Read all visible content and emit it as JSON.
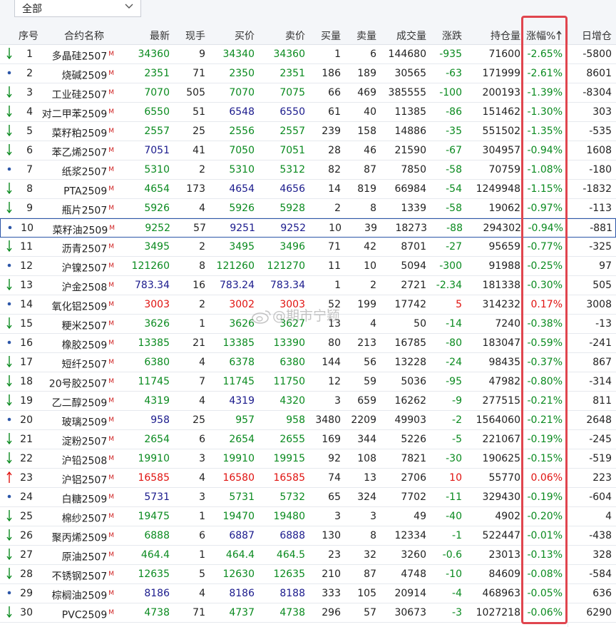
{
  "filter": {
    "label": "全部",
    "arrow_icon": "chevron-down-icon"
  },
  "headers": {
    "seq": "序号",
    "name": "合约名称",
    "last": "最新",
    "now": "现手",
    "bid": "买价",
    "ask": "卖价",
    "bid_vol": "买量",
    "ask_vol": "卖量",
    "volume": "成交量",
    "change": "涨跌",
    "open_interest": "持仓量",
    "pct": "涨幅%",
    "sort_icon": "arrow-up-icon",
    "oi_increase": "日增仓"
  },
  "colors": {
    "up": "#e0120f",
    "down": "#0a8a1f",
    "highlight_box": "#e0454e",
    "selected_row_border": "#2c56a8"
  },
  "watermark": "@期市宁颖",
  "rows": [
    {
      "ind": "down",
      "seq": "1",
      "name": "多晶硅2507",
      "mark": "M",
      "last": "34360",
      "now": "9",
      "bid": "34340",
      "ask": "34360",
      "bid_vol": "1",
      "ask_vol": "6",
      "volume": "144680",
      "change": "-935",
      "oi": "71600",
      "pct": "-2.65%",
      "inc": "-5800",
      "lc": "green",
      "bc": "green",
      "ac": "green"
    },
    {
      "ind": "dot",
      "seq": "2",
      "name": "烧碱2509",
      "mark": "M",
      "last": "2351",
      "now": "71",
      "bid": "2350",
      "ask": "2351",
      "bid_vol": "186",
      "ask_vol": "189",
      "volume": "30565",
      "change": "-63",
      "oi": "171999",
      "pct": "-2.61%",
      "inc": "8601",
      "lc": "green",
      "bc": "green",
      "ac": "green"
    },
    {
      "ind": "down",
      "seq": "3",
      "name": "工业硅2507",
      "mark": "M",
      "last": "7070",
      "now": "505",
      "bid": "7070",
      "ask": "7075",
      "bid_vol": "66",
      "ask_vol": "469",
      "volume": "385555",
      "change": "-100",
      "oi": "200193",
      "pct": "-1.39%",
      "inc": "-8304",
      "lc": "green",
      "bc": "green",
      "ac": "green"
    },
    {
      "ind": "down",
      "seq": "4",
      "name": "对二甲苯2509",
      "mark": "M",
      "last": "6550",
      "now": "51",
      "bid": "6548",
      "ask": "6550",
      "bid_vol": "61",
      "ask_vol": "40",
      "volume": "11385",
      "change": "-86",
      "oi": "151462",
      "pct": "-1.30%",
      "inc": "303",
      "lc": "green",
      "bc": "blue",
      "ac": "blue"
    },
    {
      "ind": "down",
      "seq": "5",
      "name": "菜籽粕2509",
      "mark": "M",
      "last": "2557",
      "now": "25",
      "bid": "2556",
      "ask": "2557",
      "bid_vol": "239",
      "ask_vol": "158",
      "volume": "14886",
      "change": "-35",
      "oi": "551502",
      "pct": "-1.35%",
      "inc": "-535",
      "lc": "green",
      "bc": "green",
      "ac": "green"
    },
    {
      "ind": "down",
      "seq": "6",
      "name": "苯乙烯2507",
      "mark": "M",
      "last": "7051",
      "now": "41",
      "bid": "7050",
      "ask": "7051",
      "bid_vol": "28",
      "ask_vol": "46",
      "volume": "21590",
      "change": "-67",
      "oi": "304957",
      "pct": "-0.94%",
      "inc": "1608",
      "lc": "blue",
      "bc": "green",
      "ac": "green"
    },
    {
      "ind": "dot",
      "seq": "7",
      "name": "纸浆2507",
      "mark": "M",
      "last": "5310",
      "now": "2",
      "bid": "5310",
      "ask": "5312",
      "bid_vol": "82",
      "ask_vol": "87",
      "volume": "7850",
      "change": "-58",
      "oi": "70759",
      "pct": "-1.08%",
      "inc": "-180",
      "lc": "green",
      "bc": "green",
      "ac": "green"
    },
    {
      "ind": "down",
      "seq": "8",
      "name": "PTA2509",
      "mark": "M",
      "last": "4654",
      "now": "173",
      "bid": "4654",
      "ask": "4656",
      "bid_vol": "14",
      "ask_vol": "819",
      "volume": "66984",
      "change": "-54",
      "oi": "1249948",
      "pct": "-1.15%",
      "inc": "-1832",
      "lc": "green",
      "bc": "blue",
      "ac": "blue"
    },
    {
      "ind": "down",
      "seq": "9",
      "name": "瓶片2507",
      "mark": "M",
      "last": "5926",
      "now": "4",
      "bid": "5926",
      "ask": "5928",
      "bid_vol": "2",
      "ask_vol": "8",
      "volume": "1339",
      "change": "-58",
      "oi": "19062",
      "pct": "-0.97%",
      "inc": "-113",
      "lc": "green",
      "bc": "green",
      "ac": "green"
    },
    {
      "ind": "dot",
      "seq": "10",
      "name": "菜籽油2509",
      "mark": "M",
      "last": "9252",
      "now": "57",
      "bid": "9251",
      "ask": "9252",
      "bid_vol": "10",
      "ask_vol": "39",
      "volume": "18273",
      "change": "-88",
      "oi": "294302",
      "pct": "-0.94%",
      "inc": "-881",
      "lc": "green",
      "bc": "blue",
      "ac": "blue",
      "sel": true
    },
    {
      "ind": "down",
      "seq": "11",
      "name": "沥青2507",
      "mark": "M",
      "last": "3495",
      "now": "2",
      "bid": "3495",
      "ask": "3496",
      "bid_vol": "71",
      "ask_vol": "42",
      "volume": "8701",
      "change": "-27",
      "oi": "95659",
      "pct": "-0.77%",
      "inc": "-325",
      "lc": "green",
      "bc": "green",
      "ac": "green"
    },
    {
      "ind": "dot",
      "seq": "12",
      "name": "沪镍2507",
      "mark": "M",
      "last": "121260",
      "now": "8",
      "bid": "121260",
      "ask": "121270",
      "bid_vol": "11",
      "ask_vol": "10",
      "volume": "5094",
      "change": "-300",
      "oi": "91988",
      "pct": "-0.25%",
      "inc": "97",
      "lc": "green",
      "bc": "green",
      "ac": "green"
    },
    {
      "ind": "down",
      "seq": "13",
      "name": "沪金2508",
      "mark": "M",
      "last": "783.34",
      "now": "16",
      "bid": "783.24",
      "ask": "783.34",
      "bid_vol": "1",
      "ask_vol": "2",
      "volume": "2721",
      "change": "-2.34",
      "oi": "181338",
      "pct": "-0.30%",
      "inc": "505",
      "lc": "blue",
      "bc": "blue",
      "ac": "blue"
    },
    {
      "ind": "dot",
      "seq": "14",
      "name": "氧化铝2509",
      "mark": "M",
      "last": "3003",
      "now": "2",
      "bid": "3002",
      "ask": "3003",
      "bid_vol": "52",
      "ask_vol": "199",
      "volume": "17742",
      "change": "5",
      "oi": "314232",
      "pct": "0.17%",
      "inc": "3008",
      "lc": "red",
      "bc": "red",
      "ac": "red"
    },
    {
      "ind": "down",
      "seq": "15",
      "name": "粳米2507",
      "mark": "M",
      "last": "3626",
      "now": "1",
      "bid": "3626",
      "ask": "3627",
      "bid_vol": "13",
      "ask_vol": "4",
      "volume": "50",
      "change": "-14",
      "oi": "7240",
      "pct": "-0.38%",
      "inc": "-13",
      "lc": "green",
      "bc": "green",
      "ac": "green"
    },
    {
      "ind": "dot",
      "seq": "16",
      "name": "橡胶2509",
      "mark": "M",
      "last": "13385",
      "now": "21",
      "bid": "13385",
      "ask": "13390",
      "bid_vol": "80",
      "ask_vol": "213",
      "volume": "16785",
      "change": "-80",
      "oi": "183047",
      "pct": "-0.59%",
      "inc": "-241",
      "lc": "green",
      "bc": "green",
      "ac": "green"
    },
    {
      "ind": "down",
      "seq": "17",
      "name": "短纤2507",
      "mark": "M",
      "last": "6380",
      "now": "4",
      "bid": "6378",
      "ask": "6380",
      "bid_vol": "144",
      "ask_vol": "56",
      "volume": "13228",
      "change": "-24",
      "oi": "98435",
      "pct": "-0.37%",
      "inc": "867",
      "lc": "green",
      "bc": "green",
      "ac": "green"
    },
    {
      "ind": "down",
      "seq": "18",
      "name": "20号胶2507",
      "mark": "M",
      "last": "11745",
      "now": "7",
      "bid": "11745",
      "ask": "11750",
      "bid_vol": "12",
      "ask_vol": "59",
      "volume": "5036",
      "change": "-95",
      "oi": "47982",
      "pct": "-0.80%",
      "inc": "-314",
      "lc": "green",
      "bc": "green",
      "ac": "green"
    },
    {
      "ind": "down",
      "seq": "19",
      "name": "乙二醇2509",
      "mark": "M",
      "last": "4319",
      "now": "4",
      "bid": "4319",
      "ask": "4320",
      "bid_vol": "3",
      "ask_vol": "659",
      "volume": "16262",
      "change": "-9",
      "oi": "277515",
      "pct": "-0.21%",
      "inc": "811",
      "lc": "green",
      "bc": "blue",
      "ac": "green"
    },
    {
      "ind": "dot",
      "seq": "20",
      "name": "玻璃2509",
      "mark": "M",
      "last": "958",
      "now": "25",
      "bid": "957",
      "ask": "958",
      "bid_vol": "3480",
      "ask_vol": "2209",
      "volume": "49903",
      "change": "-2",
      "oi": "1564060",
      "pct": "-0.21%",
      "inc": "2648",
      "lc": "blue",
      "bc": "green",
      "ac": "green"
    },
    {
      "ind": "down",
      "seq": "21",
      "name": "淀粉2507",
      "mark": "M",
      "last": "2654",
      "now": "6",
      "bid": "2654",
      "ask": "2655",
      "bid_vol": "169",
      "ask_vol": "344",
      "volume": "5226",
      "change": "-5",
      "oi": "221067",
      "pct": "-0.19%",
      "inc": "-245",
      "lc": "green",
      "bc": "green",
      "ac": "green"
    },
    {
      "ind": "down",
      "seq": "22",
      "name": "沪铅2508",
      "mark": "M",
      "last": "19910",
      "now": "3",
      "bid": "19910",
      "ask": "19915",
      "bid_vol": "92",
      "ask_vol": "108",
      "volume": "7821",
      "change": "-30",
      "oi": "190625",
      "pct": "-0.15%",
      "inc": "-519",
      "lc": "green",
      "bc": "green",
      "ac": "green"
    },
    {
      "ind": "up",
      "seq": "23",
      "name": "沪铝2507",
      "mark": "M",
      "last": "16585",
      "now": "4",
      "bid": "16580",
      "ask": "16585",
      "bid_vol": "74",
      "ask_vol": "13",
      "volume": "2706",
      "change": "10",
      "oi": "55770",
      "pct": "0.06%",
      "inc": "223",
      "lc": "red",
      "bc": "red",
      "ac": "red"
    },
    {
      "ind": "dot",
      "seq": "24",
      "name": "白糖2509",
      "mark": "M",
      "last": "5731",
      "now": "3",
      "bid": "5731",
      "ask": "5732",
      "bid_vol": "65",
      "ask_vol": "324",
      "volume": "7702",
      "change": "-11",
      "oi": "329430",
      "pct": "-0.19%",
      "inc": "-604",
      "lc": "blue",
      "bc": "green",
      "ac": "green"
    },
    {
      "ind": "down",
      "seq": "25",
      "name": "棉纱2507",
      "mark": "M",
      "last": "19475",
      "now": "1",
      "bid": "19470",
      "ask": "19480",
      "bid_vol": "3",
      "ask_vol": "3",
      "volume": "49",
      "change": "-40",
      "oi": "4902",
      "pct": "-0.20%",
      "inc": "4",
      "lc": "green",
      "bc": "green",
      "ac": "green"
    },
    {
      "ind": "down",
      "seq": "26",
      "name": "聚丙烯2509",
      "mark": "M",
      "last": "6888",
      "now": "6",
      "bid": "6887",
      "ask": "6888",
      "bid_vol": "130",
      "ask_vol": "8",
      "volume": "12334",
      "change": "-1",
      "oi": "522447",
      "pct": "-0.01%",
      "inc": "-438",
      "lc": "green",
      "bc": "blue",
      "ac": "blue"
    },
    {
      "ind": "down",
      "seq": "27",
      "name": "原油2507",
      "mark": "M",
      "last": "464.4",
      "now": "1",
      "bid": "464.4",
      "ask": "464.5",
      "bid_vol": "23",
      "ask_vol": "32",
      "volume": "3260",
      "change": "-0.6",
      "oi": "23013",
      "pct": "-0.13%",
      "inc": "328",
      "lc": "green",
      "bc": "green",
      "ac": "green"
    },
    {
      "ind": "down",
      "seq": "28",
      "name": "不锈钢2507",
      "mark": "M",
      "last": "12635",
      "now": "5",
      "bid": "12630",
      "ask": "12635",
      "bid_vol": "210",
      "ask_vol": "87",
      "volume": "4748",
      "change": "-10",
      "oi": "84609",
      "pct": "-0.08%",
      "inc": "-584",
      "lc": "green",
      "bc": "green",
      "ac": "green"
    },
    {
      "ind": "dot",
      "seq": "29",
      "name": "棕榈油2509",
      "mark": "M",
      "last": "8186",
      "now": "4",
      "bid": "8186",
      "ask": "8188",
      "bid_vol": "333",
      "ask_vol": "105",
      "volume": "20914",
      "change": "-4",
      "oi": "468963",
      "pct": "-0.05%",
      "inc": "636",
      "lc": "blue",
      "bc": "blue",
      "ac": "blue"
    },
    {
      "ind": "down",
      "seq": "30",
      "name": "PVC2509",
      "mark": "M",
      "last": "4738",
      "now": "71",
      "bid": "4737",
      "ask": "4738",
      "bid_vol": "296",
      "ask_vol": "57",
      "volume": "30673",
      "change": "-3",
      "oi": "1027218",
      "pct": "-0.06%",
      "inc": "6290",
      "lc": "green",
      "bc": "green",
      "ac": "green"
    }
  ]
}
